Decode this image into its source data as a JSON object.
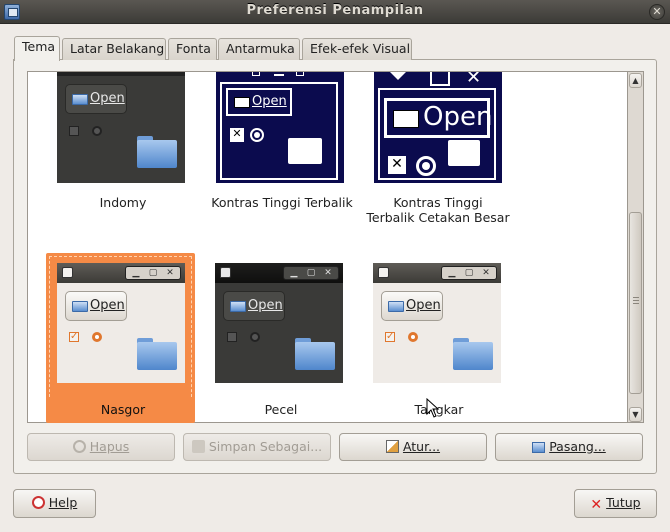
{
  "window": {
    "title": "Preferensi Penampilan"
  },
  "tabs": [
    "Tema",
    "Latar Belakang",
    "Fonta",
    "Antarmuka",
    "Efek-efek Visual"
  ],
  "active_tab": "Tema",
  "themes": [
    {
      "name": "Indomy",
      "open_label": "Open"
    },
    {
      "name": "Kontras Tinggi Terbalik",
      "open_label": "Open"
    },
    {
      "name": "Kontras Tinggi Terbalik Cetakan Besar",
      "name_line1": "Kontras Tinggi",
      "name_line2": "Terbalik Cetakan Besar",
      "open_label": "Open"
    },
    {
      "name": "Nasgor",
      "open_label": "Open",
      "selected": true
    },
    {
      "name": "Pecel",
      "open_label": "Open"
    },
    {
      "name": "Tangkar",
      "open_label": "Open"
    }
  ],
  "actions": {
    "delete": "Hapus",
    "save_as": "Simpan Sebagai...",
    "customize": "Atur...",
    "install": "Pasang..."
  },
  "footer": {
    "help": "Help",
    "close": "Tutup"
  },
  "colors": {
    "selection": "#f58a46",
    "titlebar": "#3c3b37",
    "window_bg": "#efebe7"
  }
}
